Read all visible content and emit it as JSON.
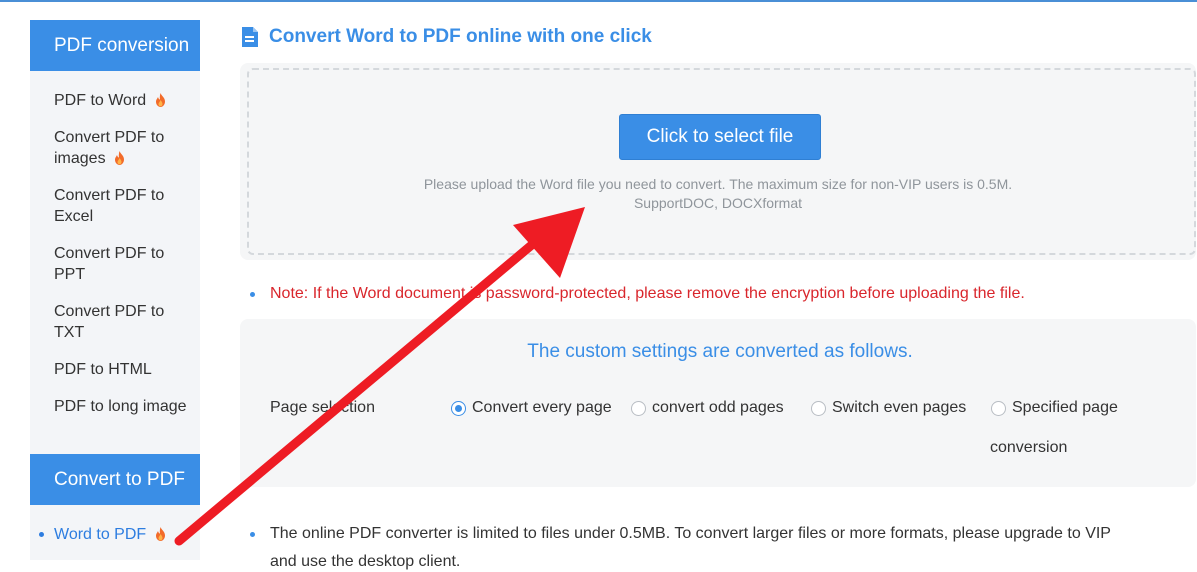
{
  "sidebar": {
    "section1_title": "PDF conversion",
    "items": [
      {
        "label": "PDF to Word",
        "hot": true
      },
      {
        "label": "Convert PDF to images",
        "hot": true
      },
      {
        "label": "Convert PDF to Excel",
        "hot": false
      },
      {
        "label": "Convert PDF to PPT",
        "hot": false
      },
      {
        "label": "Convert PDF to TXT",
        "hot": false
      },
      {
        "label": "PDF to HTML",
        "hot": false
      },
      {
        "label": "PDF to long image",
        "hot": false
      }
    ],
    "section2_title": "Convert to PDF",
    "active_item": {
      "label": "Word to PDF",
      "hot": true
    }
  },
  "main": {
    "title": "Convert Word to PDF online with one click",
    "select_button": "Click to select file",
    "hint_line1": "Please upload the Word file you need to convert. The maximum size for non-VIP users is 0.5M.",
    "hint_line2": "SupportDOC, DOCXformat",
    "note": "Note: If the Word document is password-protected, please remove the encryption before uploading the file.",
    "settings": {
      "title": "The custom settings are converted as follows.",
      "page_selection_label": "Page selection",
      "options": [
        {
          "label": "Convert every page",
          "checked": true
        },
        {
          "label": "convert odd pages",
          "checked": false
        },
        {
          "label": "Switch even pages",
          "checked": false
        },
        {
          "label": "Specified page",
          "checked": false
        }
      ],
      "option4_line2": "conversion"
    },
    "bottom_note_line1": "The online PDF converter is limited to files under 0.5MB. To convert larger files or more formats, please upgrade to VIP",
    "bottom_note_line2": "and use the desktop client."
  },
  "colors": {
    "accent": "#3a8ee6",
    "note_red": "#d9262c",
    "arrow_red": "#ee1c24",
    "panel_bg": "#f5f6f7",
    "sidebar_bg": "#f3f5f8"
  },
  "icons": [
    "document-icon",
    "fire-icon",
    "arrow-annotation"
  ]
}
